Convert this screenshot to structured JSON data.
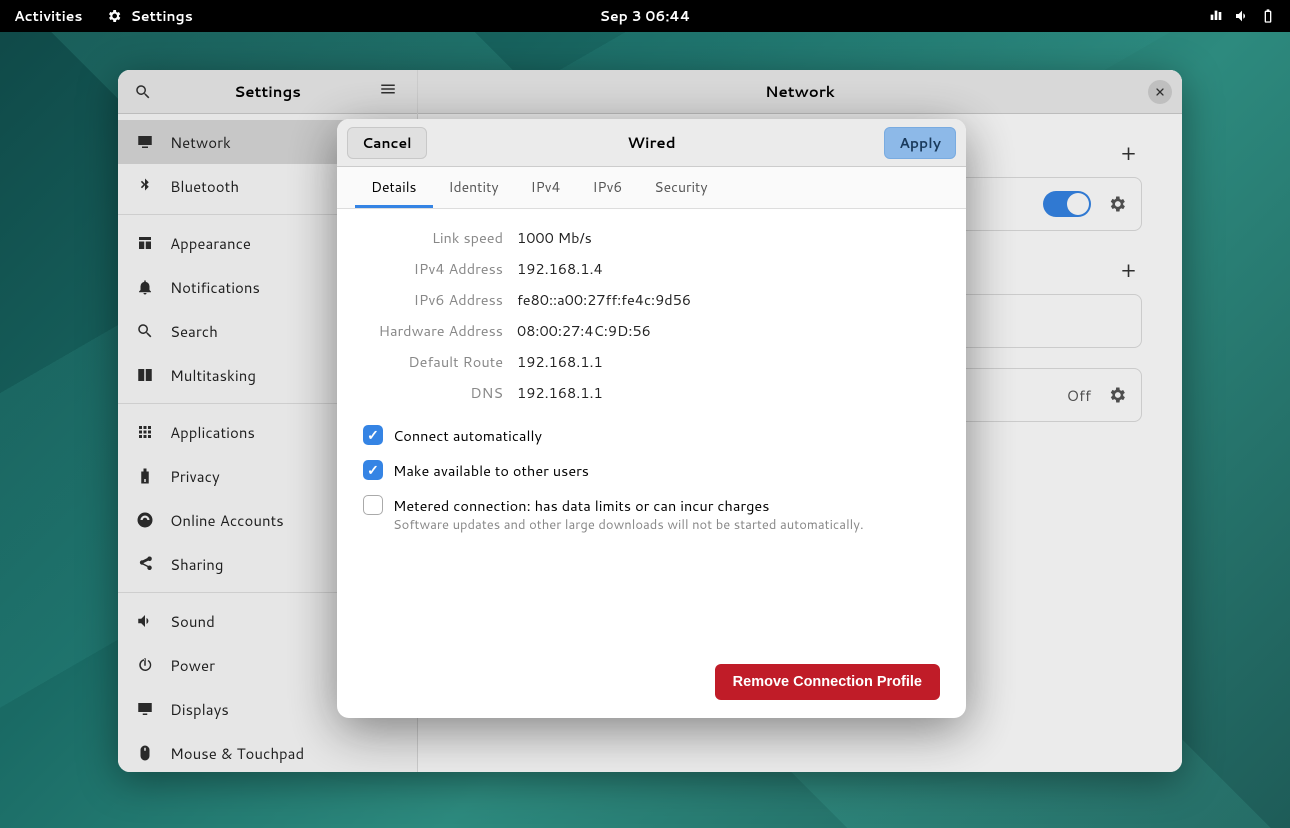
{
  "topbar": {
    "activities": "Activities",
    "appName": "Settings",
    "datetime": "Sep 3  06:44"
  },
  "sidebar": {
    "title": "Settings",
    "groups": [
      [
        {
          "icon": "monitor",
          "label": "Network",
          "active": true
        },
        {
          "icon": "bluetooth",
          "label": "Bluetooth"
        }
      ],
      [
        {
          "icon": "appearance",
          "label": "Appearance"
        },
        {
          "icon": "bell",
          "label": "Notifications"
        },
        {
          "icon": "search",
          "label": "Search"
        },
        {
          "icon": "multitask",
          "label": "Multitasking"
        }
      ],
      [
        {
          "icon": "apps",
          "label": "Applications"
        },
        {
          "icon": "privacy",
          "label": "Privacy"
        },
        {
          "icon": "online",
          "label": "Online Accounts"
        },
        {
          "icon": "share",
          "label": "Sharing"
        }
      ],
      [
        {
          "icon": "sound",
          "label": "Sound"
        },
        {
          "icon": "power",
          "label": "Power"
        },
        {
          "icon": "displays",
          "label": "Displays"
        },
        {
          "icon": "mouse",
          "label": "Mouse & Touchpad"
        }
      ]
    ]
  },
  "content": {
    "title": "Network",
    "row3_off": "Off"
  },
  "dialog": {
    "cancel": "Cancel",
    "apply": "Apply",
    "title": "Wired",
    "tabs": [
      "Details",
      "Identity",
      "IPv4",
      "IPv6",
      "Security"
    ],
    "activeTab": 0,
    "details": [
      {
        "label": "Link speed",
        "value": "1000 Mb/s"
      },
      {
        "label": "IPv4 Address",
        "value": "192.168.1.4"
      },
      {
        "label": "IPv6 Address",
        "value": "fe80::a00:27ff:fe4c:9d56"
      },
      {
        "label": "Hardware Address",
        "value": "08:00:27:4C:9D:56"
      },
      {
        "label": "Default Route",
        "value": "192.168.1.1"
      },
      {
        "label": "DNS",
        "value": "192.168.1.1"
      }
    ],
    "checks": [
      {
        "label": "Connect automatically",
        "checked": true
      },
      {
        "label": "Make available to other users",
        "checked": true
      },
      {
        "label": "Metered connection: has data limits or can incur charges",
        "sub": "Software updates and other large downloads will not be started automatically.",
        "checked": false
      }
    ],
    "remove": "Remove Connection Profile"
  }
}
